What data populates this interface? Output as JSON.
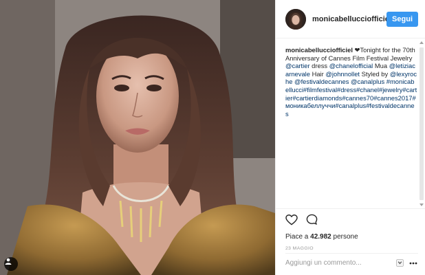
{
  "post": {
    "username": "monicabellucciofficiel",
    "follow_label": "Segui",
    "caption_user": "monicabellucciofficiel",
    "caption_parts": [
      {
        "type": "text",
        "text": " ❤Tonight for the 70th Anniversary of Cannes Film Festival Jewelry "
      },
      {
        "type": "link",
        "text": "@cartier"
      },
      {
        "type": "text",
        "text": " dress "
      },
      {
        "type": "link",
        "text": "@chanelofficial"
      },
      {
        "type": "text",
        "text": " Mua "
      },
      {
        "type": "link",
        "text": "@letiziacarnevale"
      },
      {
        "type": "text",
        "text": " Hair "
      },
      {
        "type": "link",
        "text": "@johnnollet"
      },
      {
        "type": "text",
        "text": " Styled by "
      },
      {
        "type": "link",
        "text": "@lexyroche"
      },
      {
        "type": "text",
        "text": " "
      },
      {
        "type": "link",
        "text": "@festivaldecannes"
      },
      {
        "type": "text",
        "text": " "
      },
      {
        "type": "link",
        "text": "@canalplus"
      },
      {
        "type": "text",
        "text": " "
      },
      {
        "type": "link",
        "text": "#monicabellucci#filmfestival#dress#chanel#jewelry#cartier#cartierdiamonds#cannes70#cannes2017#моникабеллуччи#canalplus#festivaldecannes"
      }
    ],
    "likes_prefix": "Piace a ",
    "likes_count": "42.982",
    "likes_suffix": " persone",
    "date": "23 MAGGIO",
    "comment_placeholder": "Aggiungi un commento..."
  },
  "icons": {
    "like": "heart-icon",
    "comment": "comment-icon",
    "corner": "user-tag-icon",
    "save": "save-icon",
    "more": "more-options-icon"
  },
  "colors": {
    "accent": "#3897f0",
    "link": "#003569",
    "text": "#262626",
    "muted": "#999999"
  }
}
